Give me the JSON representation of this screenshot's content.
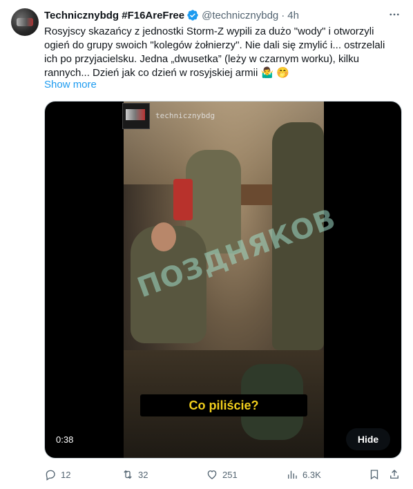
{
  "tweet": {
    "author": {
      "name": "Technicznybdg #F16AreFree",
      "handle": "@technicznybdg",
      "separator": "·",
      "time": "4h",
      "verified": true,
      "verified_color": "#1d9bf0"
    },
    "text": {
      "line1": "Rosyjscy skazańcy z jednostki Storm-Z wypili za dużo \"wody\" i otworzyli",
      "line2": "ogień do grupy swoich \"kolegów żołnierzy\". Nie dali się zmylić i... ostrzelali",
      "line3": "ich po przyjacielsku. Jedna „dwusetka” (leży w czarnym worku), kilku",
      "line4": "rannych... Dzień jak co dzień w rosyjskiej armii",
      "emoji1": "🤷‍♂️",
      "emoji2": "🤭"
    },
    "show_more": "Show more",
    "link_color": "#1d9bf0",
    "media": {
      "watermark_handle": "technicznybdg",
      "watermark_text": "ПОЗДНЯКОВ",
      "caption": "Co piliście?",
      "caption_color": "#f2cf1c",
      "duration": "0:38",
      "hide_label": "Hide"
    },
    "actions": {
      "replies": "12",
      "reposts": "32",
      "likes": "251",
      "views": "6.3K"
    },
    "icons": {
      "more": "more-icon",
      "verified": "verified-badge-icon",
      "reply": "reply-icon",
      "repost": "repost-icon",
      "like": "like-icon",
      "views": "views-icon",
      "bookmark": "bookmark-icon",
      "share": "share-icon"
    }
  }
}
